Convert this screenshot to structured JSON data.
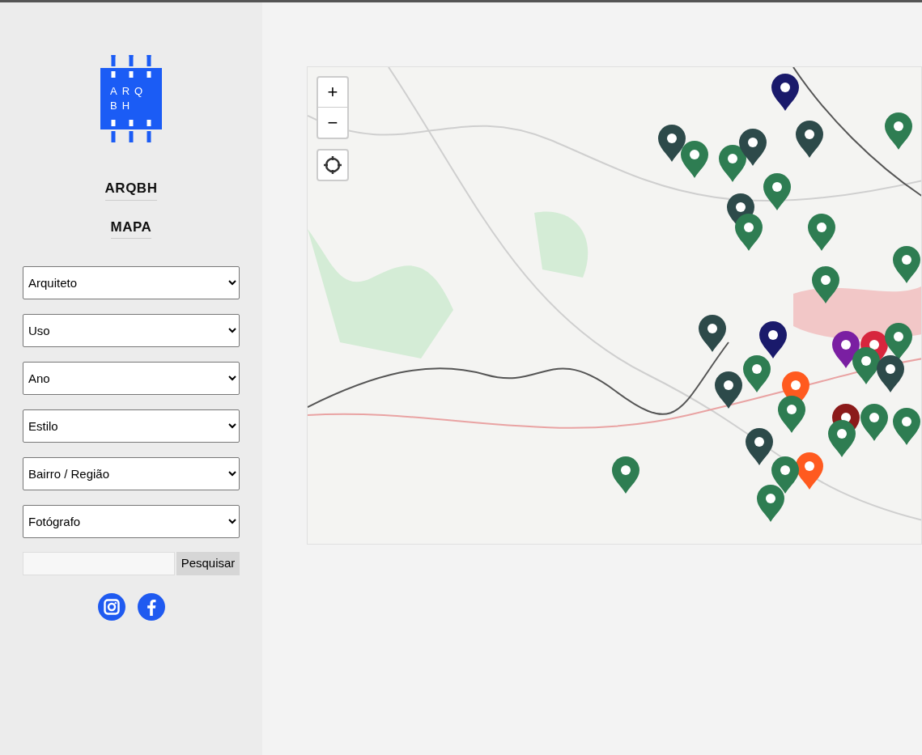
{
  "logo": {
    "lines": [
      "ARQ",
      "BH"
    ]
  },
  "nav": [
    {
      "label": "ARQBH"
    },
    {
      "label": "MAPA"
    }
  ],
  "filters": [
    {
      "label": "Arquiteto"
    },
    {
      "label": "Uso"
    },
    {
      "label": "Ano"
    },
    {
      "label": "Estilo"
    },
    {
      "label": "Bairro / Região"
    },
    {
      "label": "Fotógrafo"
    }
  ],
  "search": {
    "button": "Pesquisar"
  },
  "social": [
    {
      "kind": "instagram"
    },
    {
      "kind": "facebook"
    }
  ],
  "map": {
    "controls": [
      {
        "kind": "zoom",
        "label": "+"
      },
      {
        "kind": "zoom",
        "label": "−"
      },
      {
        "kind": "locate"
      }
    ]
  }
}
